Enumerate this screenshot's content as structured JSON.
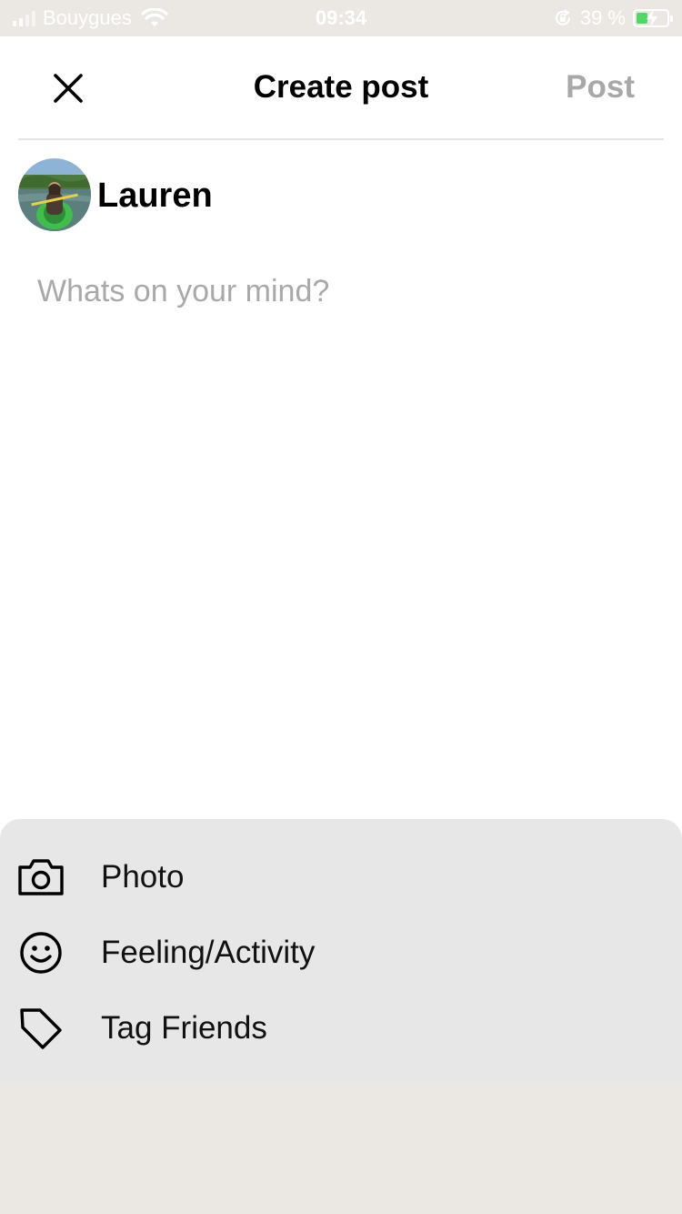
{
  "status_bar": {
    "carrier": "Bouygues",
    "time": "09:34",
    "battery_percent": "39 %",
    "battery_level": 0.39,
    "icons": [
      "signal-icon",
      "wifi-icon",
      "rotation-lock-icon",
      "battery-charging-icon"
    ]
  },
  "header": {
    "title": "Create post",
    "post_label": "Post",
    "close_icon": "close-icon"
  },
  "user": {
    "name": "Lauren",
    "avatar_icon": "profile-photo"
  },
  "composer": {
    "placeholder": "Whats on your mind?",
    "value": ""
  },
  "actions": [
    {
      "label": "Photo",
      "icon": "camera-icon"
    },
    {
      "label": "Feeling/Activity",
      "icon": "smiley-icon"
    },
    {
      "label": "Tag Friends",
      "icon": "tag-icon"
    }
  ],
  "colors": {
    "status_bar_bg": "#ebe7e3",
    "post_disabled": "#a8a8a8",
    "placeholder": "#a9a9a9",
    "sheet_bg": "#e7e7e7",
    "battery_fill": "#4cd964"
  }
}
